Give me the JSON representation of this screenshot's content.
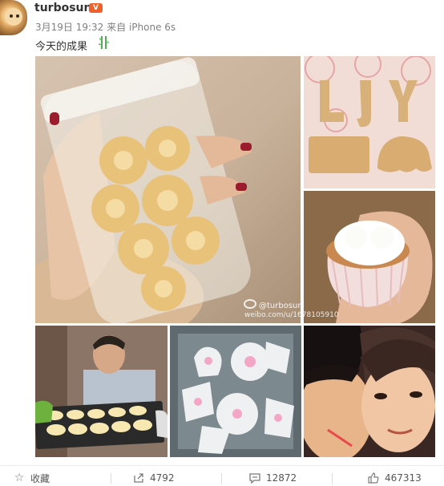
{
  "post": {
    "username": "turbosun",
    "badge": "V",
    "timestamp": "3月19日 19:32",
    "source": "来自 iPhone 6s",
    "text": "今天的成果"
  },
  "images": [
    {
      "alt": "hand-holding-cookie-jar"
    },
    {
      "alt": "letter-cookies-ljy"
    },
    {
      "alt": "cupcake-in-hand"
    },
    {
      "alt": "man-with-muffin-tray"
    },
    {
      "alt": "wrapped-cookies"
    },
    {
      "alt": "selfie-two-people"
    }
  ],
  "watermark": {
    "brand": "@turbosun",
    "url": "weibo.com/u/1678105910"
  },
  "actions": {
    "favorite": {
      "label": "收藏",
      "icon": "star-icon"
    },
    "repost": {
      "count": "4792",
      "icon": "share-icon"
    },
    "comment": {
      "count": "12872",
      "icon": "comment-icon"
    },
    "like": {
      "count": "467313",
      "icon": "thumbs-up-icon"
    }
  },
  "colors": {
    "accent": "#f0602a",
    "text": "#333333",
    "muted": "#808080"
  }
}
